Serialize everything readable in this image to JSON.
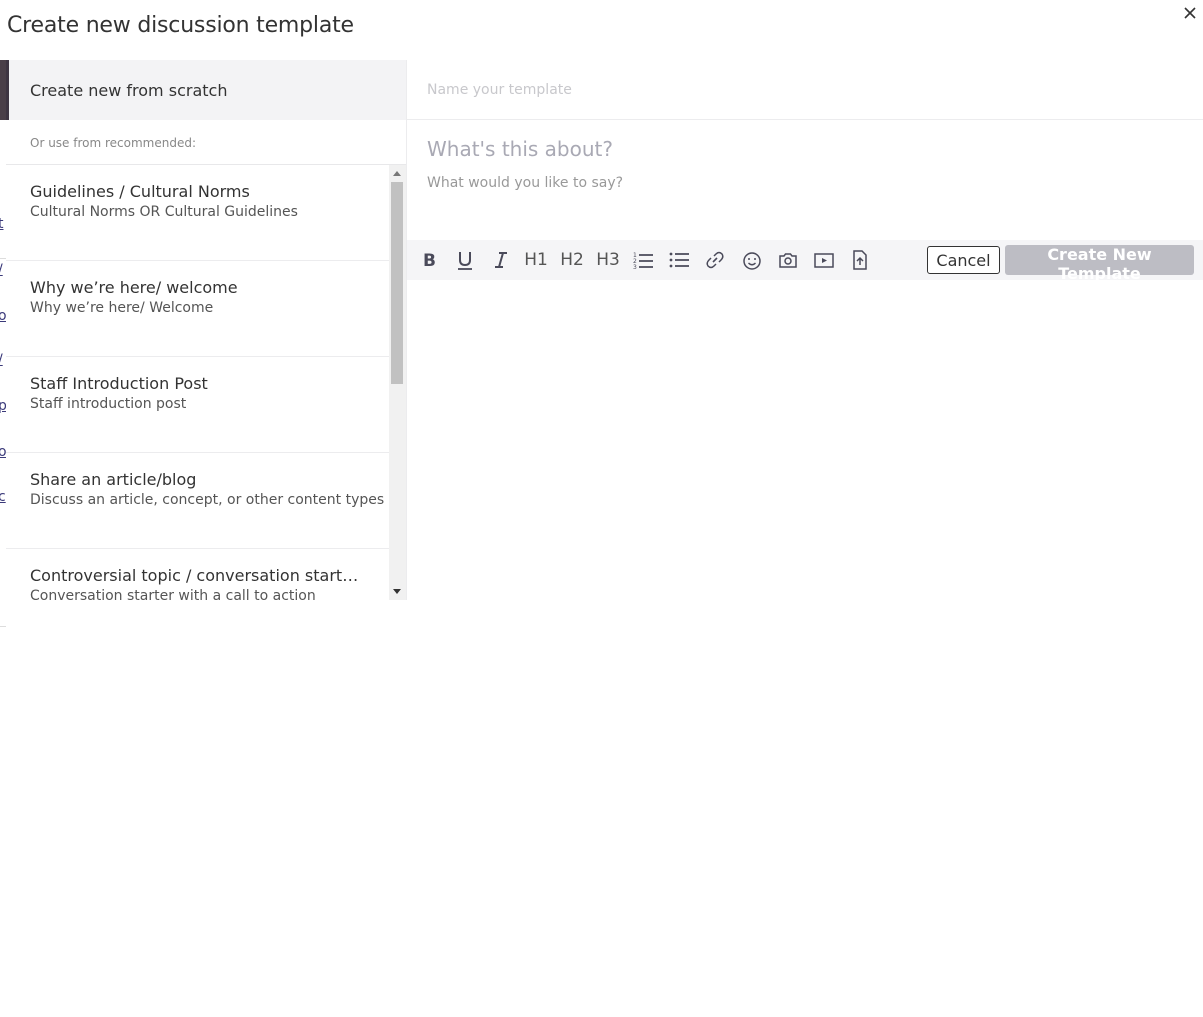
{
  "modal": {
    "title": "Create new discussion template"
  },
  "left": {
    "scratch_label": "Create new from scratch",
    "recommended_label": "Or use from recommended:",
    "templates": [
      {
        "title": "Guidelines / Cultural Norms",
        "subtitle": "Cultural Norms OR Cultural Guidelines"
      },
      {
        "title": "Why we’re here/ welcome",
        "subtitle": "Why we’re here/ Welcome"
      },
      {
        "title": "Staff Introduction Post",
        "subtitle": "Staff introduction post"
      },
      {
        "title": "Share an article/blog",
        "subtitle": "Discuss an article, concept, or other content types"
      },
      {
        "title": "Controversial topic / conversation starter...",
        "subtitle": "Conversation starter with a call to action"
      }
    ]
  },
  "editor": {
    "name_placeholder": "Name your template",
    "subject_placeholder": "What's this about?",
    "body_placeholder": "What would you like to say?"
  },
  "toolbar": {
    "h1": "H1",
    "h2": "H2",
    "h3": "H3",
    "cancel_label": "Cancel",
    "create_label": "Create New Template"
  },
  "background_fragments": [
    "t",
    "/",
    "o",
    "/",
    "p",
    "o",
    "c"
  ]
}
